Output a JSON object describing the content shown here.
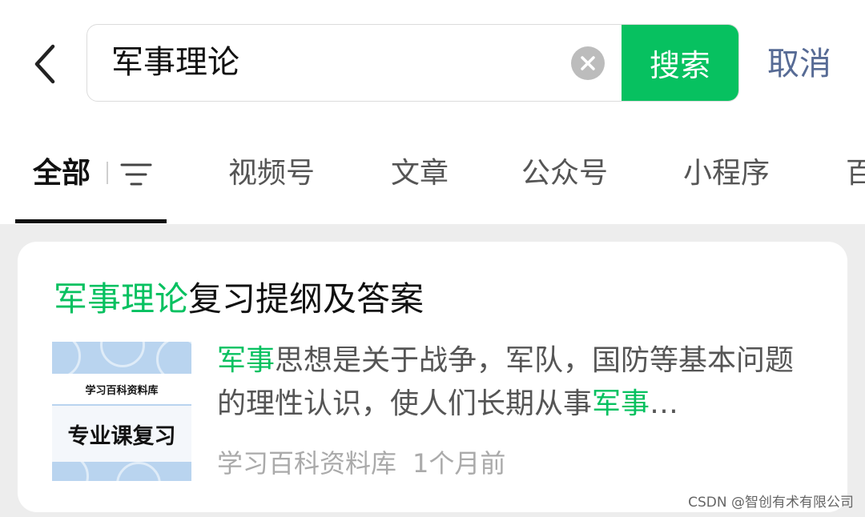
{
  "header": {
    "query": "军事理论",
    "search_label": "搜索",
    "cancel_label": "取消"
  },
  "tabs": [
    {
      "label": "全部",
      "active": true
    },
    {
      "label": "视频号"
    },
    {
      "label": "文章"
    },
    {
      "label": "公众号"
    },
    {
      "label": "小程序"
    },
    {
      "label": "百"
    }
  ],
  "result": {
    "title_highlight": "军事理论",
    "title_rest": "复习提纲及答案",
    "thumbnail": {
      "line1": "学习百科资料库",
      "line2": "专业课复习"
    },
    "desc_highlight_1": "军事",
    "desc_part_1": "思想是关于战争，军队，国防等基本问题的理性认识，使人们长期从事",
    "desc_highlight_2": "军事",
    "desc_ellipsis": "…",
    "source": "学习百科资料库",
    "time": "1个月前"
  },
  "watermark": "CSDN @智创有术有限公司",
  "colors": {
    "accent": "#07c160",
    "link": "#576b95",
    "background": "#ededed"
  },
  "icons": [
    "back-arrow-icon",
    "clear-icon",
    "filter-icon"
  ]
}
